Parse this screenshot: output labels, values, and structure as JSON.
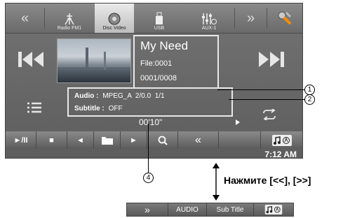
{
  "topbar": {
    "prev_glyph": "«",
    "next_glyph": "»",
    "tabs": [
      {
        "label": "Radio FM1",
        "icon": "antenna-icon"
      },
      {
        "label": "Disc Video",
        "icon": "disc-icon"
      },
      {
        "label": "USB",
        "icon": "usb-icon"
      },
      {
        "label": "AUX-1",
        "icon": "mixer-icon"
      }
    ],
    "settings_icon": "wrench-icon"
  },
  "nav": {
    "prev_track_glyph": "⏮",
    "next_track_glyph": "⏭"
  },
  "track": {
    "title": "My Need",
    "file": "File:0001",
    "counter": "0001/0008"
  },
  "audio_info": {
    "audio_label": "Audio :",
    "audio_value": "MPEG_A  2/0.0  1/1",
    "subtitle_label": "Subtitle :",
    "subtitle_value": "OFF"
  },
  "playback": {
    "elapsed": "00'10\"",
    "clock": "7:12 AM"
  },
  "controls": {
    "play_pause": "►/II",
    "stop": "■",
    "prev": "◄",
    "next": "►",
    "more": "«"
  },
  "callouts": {
    "c1": "1",
    "c2": "2",
    "c4": "4"
  },
  "instruction": "Нажмите [<<], [>>]",
  "lower_bar": {
    "more": "»",
    "audio": "AUDIO",
    "subtitle": "Sub Title"
  },
  "colors": {
    "active_tab": "#d8d8d8",
    "screen": "#686868"
  }
}
